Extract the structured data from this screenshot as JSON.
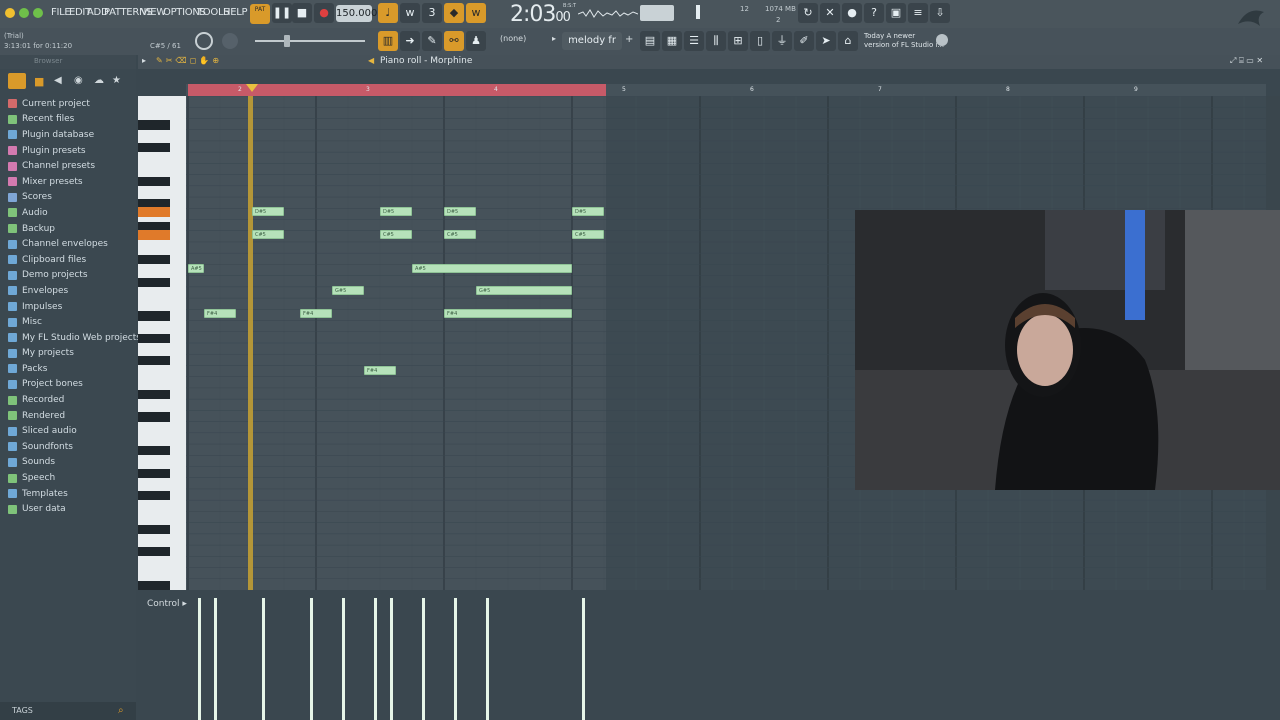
{
  "menu": [
    "FILE",
    "EDIT",
    "ADD",
    "PATTERNS",
    "VIEW",
    "OPTIONS",
    "TOOLS",
    "HELP"
  ],
  "pat_label": "PAT",
  "tempo": "150.000",
  "clock": "2:03",
  "clock_sub": "00",
  "clock_zone": "B:S:T",
  "cpu": "12",
  "mem": "1074 MB",
  "mem2": "2",
  "hint_top": "(Trial)",
  "hint_pos": "3:13:01 for 0:11:20",
  "note_info": "C#5 / 61",
  "snap": "(none)",
  "pattern_name": "melody fr",
  "news_line1": "Today  A newer",
  "news_line2": "version of FL Studio i...",
  "browser_title": "Browser",
  "browser_items": [
    {
      "label": "Current project",
      "color": "#d46a6a"
    },
    {
      "label": "Recent files",
      "color": "#7fc37a"
    },
    {
      "label": "Plugin database",
      "color": "#6fa8d6"
    },
    {
      "label": "Plugin presets",
      "color": "#d47ab0"
    },
    {
      "label": "Channel presets",
      "color": "#d47ab0"
    },
    {
      "label": "Mixer presets",
      "color": "#d47ab0"
    },
    {
      "label": "Scores",
      "color": "#7fa6d6"
    },
    {
      "label": "Audio",
      "color": "#7fc37a"
    },
    {
      "label": "Backup",
      "color": "#7fc37a"
    },
    {
      "label": "Channel envelopes",
      "color": "#6fa8d6"
    },
    {
      "label": "Clipboard files",
      "color": "#6fa8d6"
    },
    {
      "label": "Demo projects",
      "color": "#6fa8d6"
    },
    {
      "label": "Envelopes",
      "color": "#6fa8d6"
    },
    {
      "label": "Impulses",
      "color": "#6fa8d6"
    },
    {
      "label": "Misc",
      "color": "#6fa8d6"
    },
    {
      "label": "My FL Studio Web projects",
      "color": "#6fa8d6"
    },
    {
      "label": "My projects",
      "color": "#6fa8d6"
    },
    {
      "label": "Packs",
      "color": "#6fa8d6"
    },
    {
      "label": "Project bones",
      "color": "#6fa8d6"
    },
    {
      "label": "Recorded",
      "color": "#7fc37a"
    },
    {
      "label": "Rendered",
      "color": "#7fc37a"
    },
    {
      "label": "Sliced audio",
      "color": "#6fa8d6"
    },
    {
      "label": "Soundfonts",
      "color": "#6fa8d6"
    },
    {
      "label": "Sounds",
      "color": "#6fa8d6"
    },
    {
      "label": "Speech",
      "color": "#7fc37a"
    },
    {
      "label": "Templates",
      "color": "#6fa8d6"
    },
    {
      "label": "User data",
      "color": "#7fc37a"
    }
  ],
  "tags_label": "TAGS",
  "piano_roll_title": "Piano roll - Morphine",
  "ruler_bars": [
    "2",
    "3",
    "4",
    "5",
    "6",
    "7",
    "8",
    "9"
  ],
  "control_label": "Control",
  "notes": [
    {
      "pitch": "D#5",
      "bar": 2.0,
      "len": 0.25
    },
    {
      "pitch": "C#5",
      "bar": 2.0,
      "len": 0.25
    },
    {
      "pitch": "D#5",
      "bar": 3.0,
      "len": 0.25
    },
    {
      "pitch": "C#5",
      "bar": 3.0,
      "len": 0.25
    },
    {
      "pitch": "D#5",
      "bar": 3.5,
      "len": 0.25
    },
    {
      "pitch": "C#5",
      "bar": 3.5,
      "len": 0.25
    },
    {
      "pitch": "D#5",
      "bar": 4.5,
      "len": 0.25
    },
    {
      "pitch": "C#5",
      "bar": 4.5,
      "len": 0.25
    },
    {
      "pitch": "A#5",
      "bar": 1.5,
      "len": 0.125
    },
    {
      "pitch": "A#5",
      "bar": 3.25,
      "len": 1.25
    },
    {
      "pitch": "G#5",
      "bar": 2.625,
      "len": 0.25
    },
    {
      "pitch": "G#5",
      "bar": 3.75,
      "len": 0.75
    },
    {
      "pitch": "F#4",
      "bar": 1.625,
      "len": 0.25
    },
    {
      "pitch": "F#4",
      "bar": 2.375,
      "len": 0.25
    },
    {
      "pitch": "F#4",
      "bar": 3.5,
      "len": 1.0
    },
    {
      "pitch": "F#4",
      "bar": 2.875,
      "len": 0.25
    }
  ]
}
